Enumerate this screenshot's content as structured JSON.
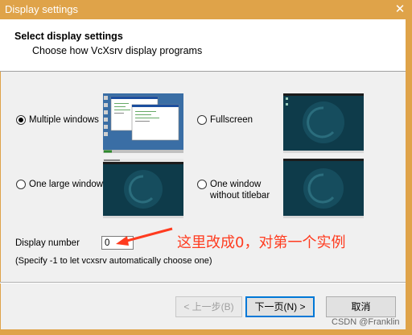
{
  "window": {
    "title": "Display settings"
  },
  "header": {
    "title": "Select display settings",
    "subtitle": "Choose how VcXsrv display programs"
  },
  "options": [
    {
      "label": "Multiple windows",
      "selected": true
    },
    {
      "label": "Fullscreen",
      "selected": false
    },
    {
      "label": "One large window",
      "selected": false
    },
    {
      "label": "One window",
      "label2": "without titlebar",
      "selected": false
    }
  ],
  "display_number": {
    "label": "Display number",
    "value": "0",
    "hint": "(Specify -1 to let vcxsrv automatically choose one)"
  },
  "annotation": {
    "text": "这里改成0，对第一个实例",
    "color": "#ff3b1f"
  },
  "buttons": {
    "back": "< 上一步(B)",
    "next": "下一页(N) >",
    "cancel": "取消"
  },
  "watermark": "CSDN @Franklin",
  "colors": {
    "titlebar": "#dfa349",
    "desktop": "#0e3b4a",
    "win_desktop": "#3a6ea5"
  }
}
